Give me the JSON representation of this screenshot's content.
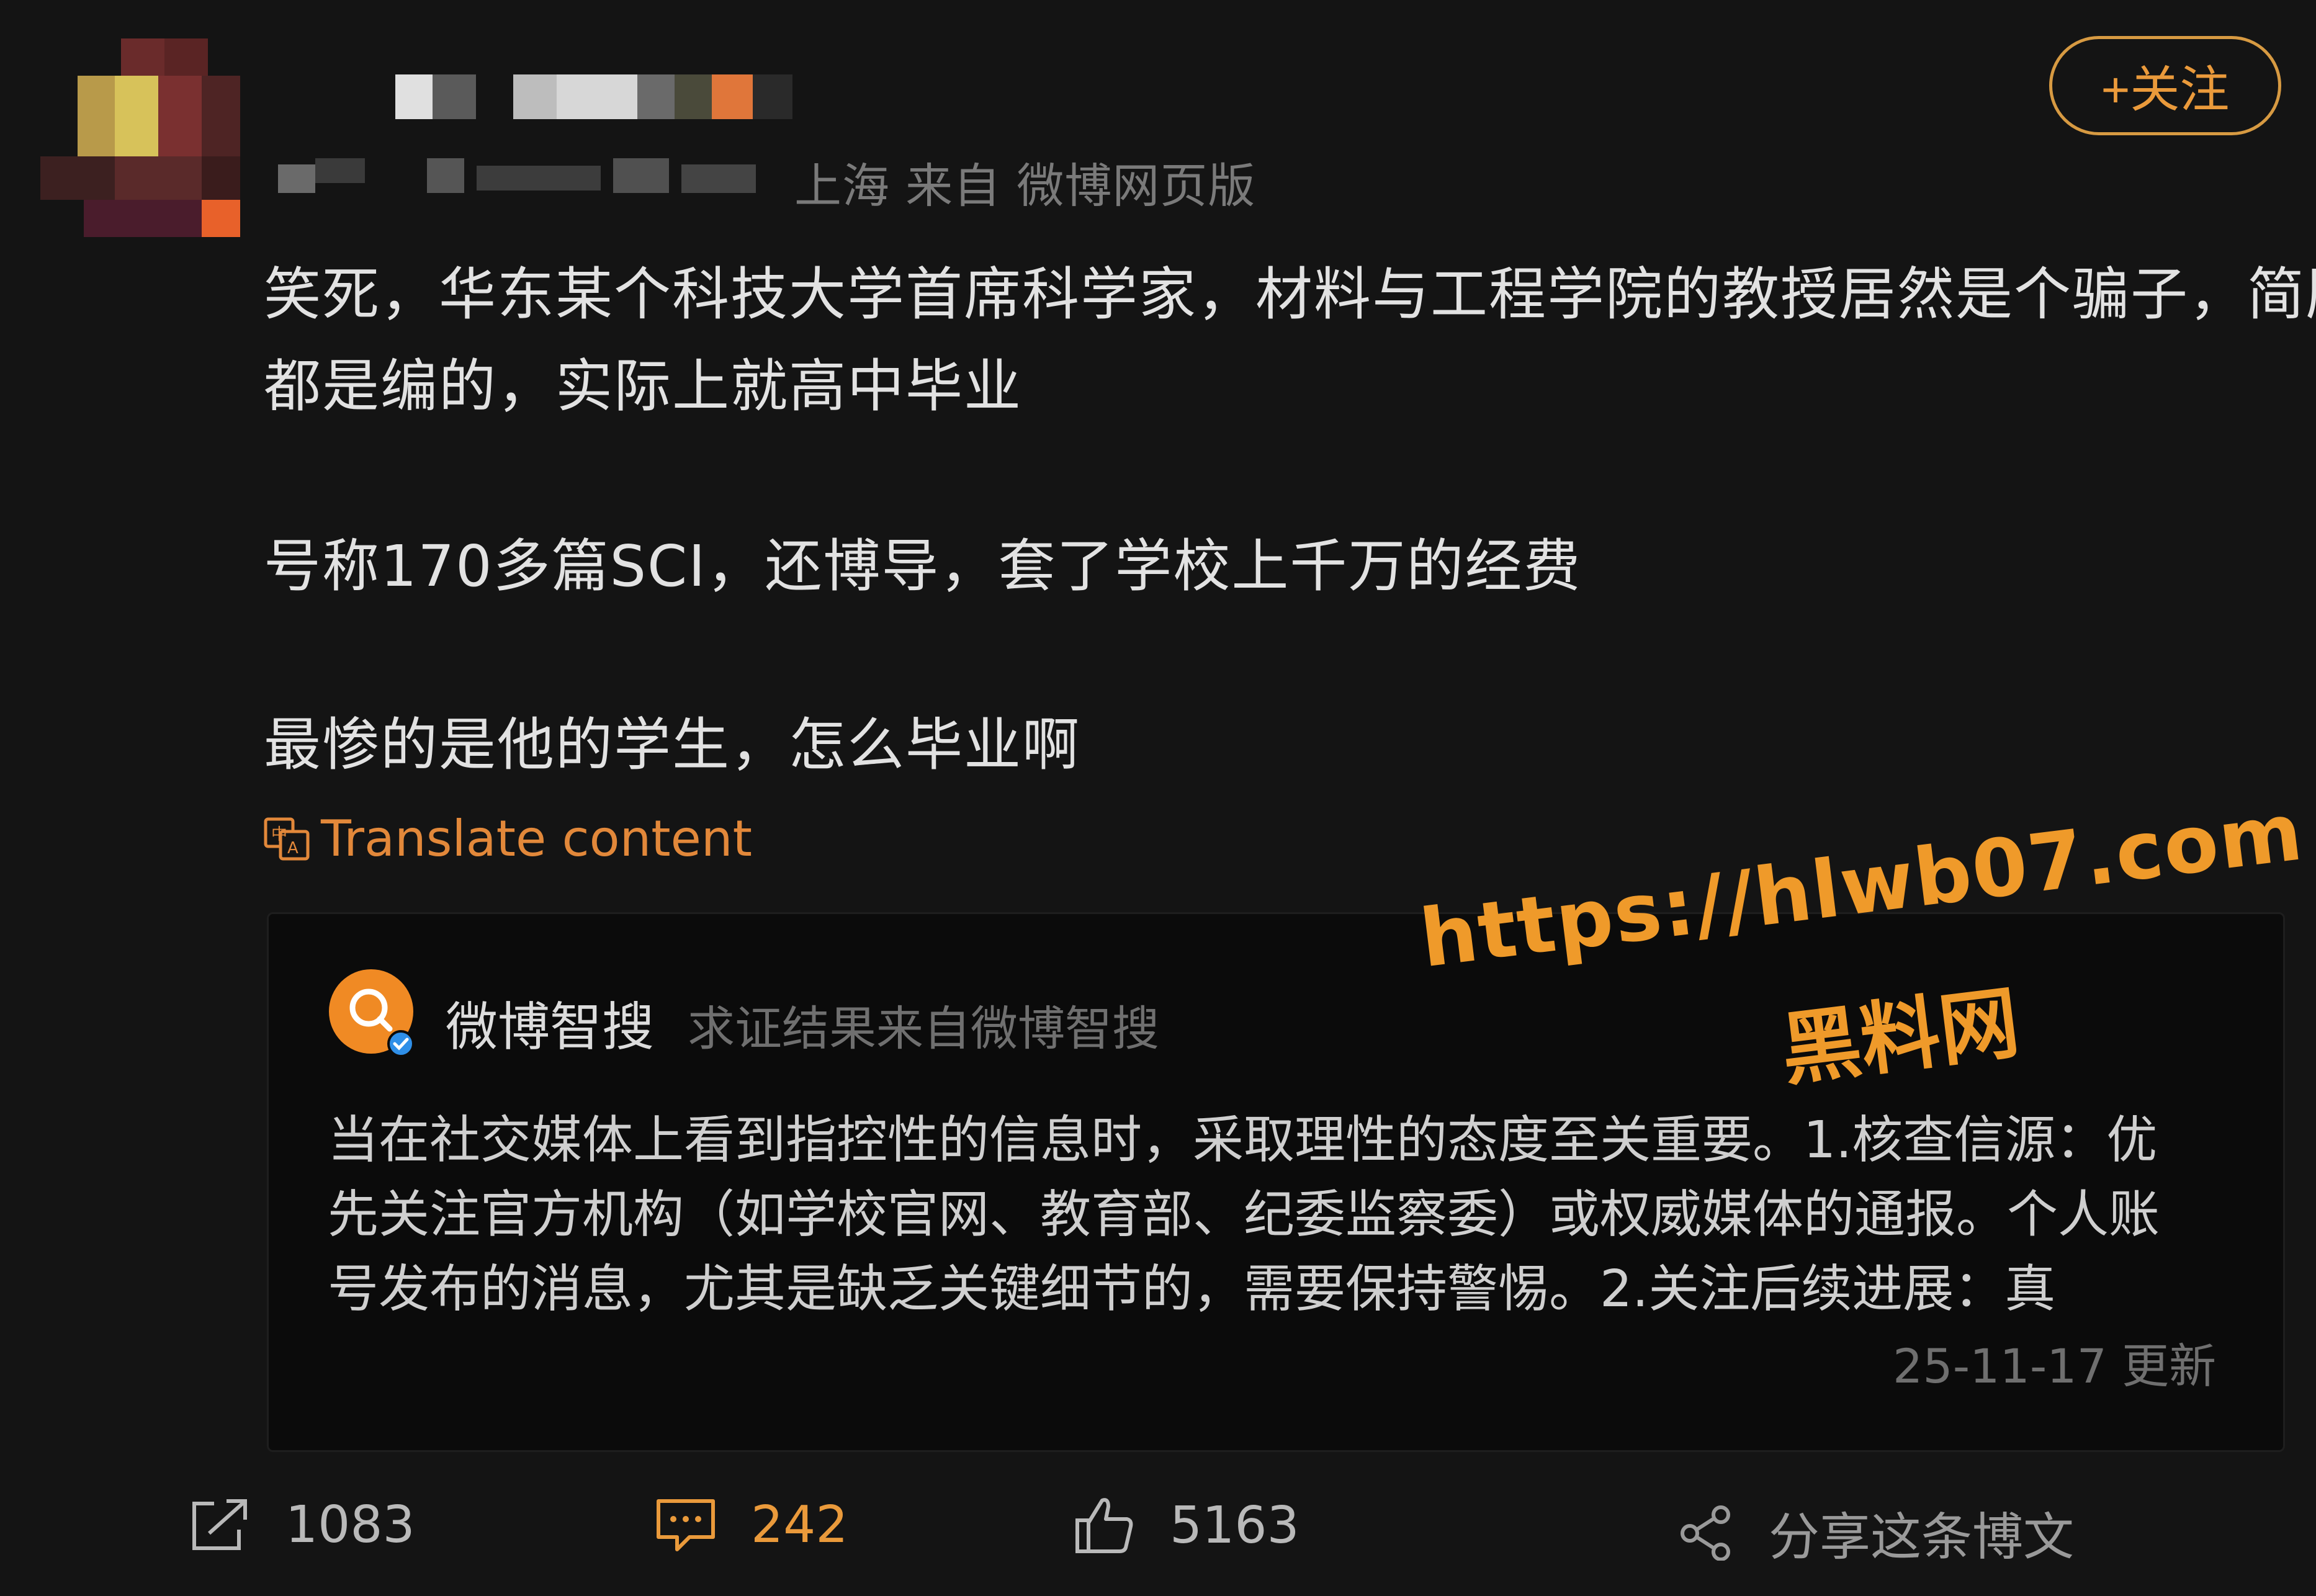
{
  "post": {
    "meta_visible": "上海 来自 微博网页版",
    "follow_label": "+关注",
    "text_lines": [
      "笑死，华东某个科技大学首席科学家，材料与工程学院的教授居然是个骗子，简历",
      "都是编的，实际上就高中毕业",
      "号称170多篇SCI，还博导，套了学校上千万的经费",
      "最惨的是他的学生，怎么毕业啊"
    ],
    "translate_label": "Translate content"
  },
  "smart_card": {
    "name": "微博智搜",
    "subtitle": "求证结果来自微博智搜",
    "lines": [
      "当在社交媒体上看到指控性的信息时，采取理性的态度至关重要。1.核查信源：优",
      "先关注官方机构（如学校官网、教育部、纪委监察委）或权威媒体的通报。个人账",
      "号发布的消息，尤其是缺乏关键细节的，需要保持警惕。2.关注后续进展：真"
    ],
    "updated": "25-11-17 更新"
  },
  "watermark": {
    "url": "https://hlwb07.com",
    "name": "黑料网"
  },
  "actions": {
    "repost_count": "1083",
    "comment_count": "242",
    "like_count": "5163",
    "share_label": "分享这条博文"
  },
  "colors": {
    "accent": "#ea9a3b",
    "background": "#141414",
    "card_bg": "#0b0b0b"
  },
  "icons": [
    "repost-icon",
    "comment-icon",
    "like-icon",
    "share-icon",
    "translate-icon",
    "smart-search-logo-icon",
    "verified-badge-icon"
  ]
}
